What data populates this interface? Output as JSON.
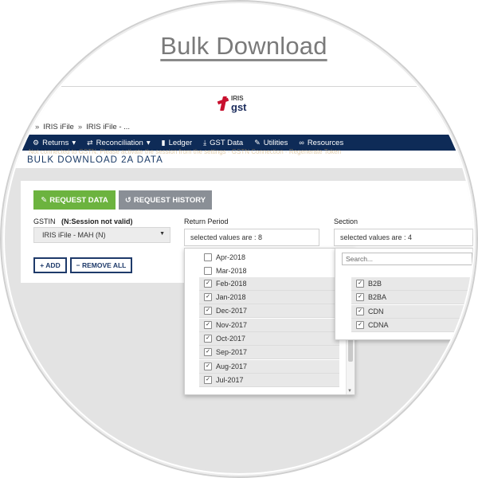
{
  "title": "Bulk Download",
  "breadcrumb": {
    "item1": "IRIS iFile",
    "item2": "IRIS iFile - ..."
  },
  "logo": {
    "line1": "IRIS",
    "line2": "gst"
  },
  "nav": [
    {
      "label": "Returns",
      "icon": "gear-icon",
      "caret": "▾"
    },
    {
      "label": "Reconciliation",
      "icon": "swap-icon",
      "caret": "▾"
    },
    {
      "label": "Ledger",
      "icon": "book-icon"
    },
    {
      "label": "GST Data",
      "icon": "download-icon"
    },
    {
      "label": "Utilities",
      "icon": "wrench-icon"
    },
    {
      "label": "Resources",
      "icon": "link-icon"
    }
  ],
  "page": {
    "note": "Not connected to GSTN. Please activate the session from the settings - GSTN Connection - Regenerate Token",
    "heading": "BULK DOWNLOAD 2A DATA"
  },
  "tabs": {
    "request": "REQUEST DATA",
    "history": "REQUEST HISTORY"
  },
  "gstin": {
    "label": "GSTIN",
    "status": "(N:Session not valid)",
    "value": "IRIS iFile - MAH (N)"
  },
  "return_period": {
    "label": "Return Period",
    "summary": "selected values are : 8",
    "options": [
      {
        "label": "Apr-2018",
        "checked": false
      },
      {
        "label": "Mar-2018",
        "checked": false
      },
      {
        "label": "Feb-2018",
        "checked": true
      },
      {
        "label": "Jan-2018",
        "checked": true
      },
      {
        "label": "Dec-2017",
        "checked": true
      },
      {
        "label": "Nov-2017",
        "checked": true
      },
      {
        "label": "Oct-2017",
        "checked": true
      },
      {
        "label": "Sep-2017",
        "checked": true
      },
      {
        "label": "Aug-2017",
        "checked": true
      },
      {
        "label": "Jul-2017",
        "checked": true
      }
    ]
  },
  "section": {
    "label": "Section",
    "summary": "selected values are : 4",
    "search_placeholder": "Search...",
    "options": [
      {
        "label": "B2B",
        "checked": true
      },
      {
        "label": "B2BA",
        "checked": true
      },
      {
        "label": "CDN",
        "checked": true
      },
      {
        "label": "CDNA",
        "checked": true
      }
    ]
  },
  "buttons": {
    "add": "+ ADD",
    "remove_all": "− REMOVE ALL"
  },
  "colors": {
    "navbar": "#0e2b57",
    "request_tab": "#6cb33f",
    "history_tab": "#8a8f96",
    "heading": "#1a3a66",
    "outline_button": "#1e3a6a"
  }
}
